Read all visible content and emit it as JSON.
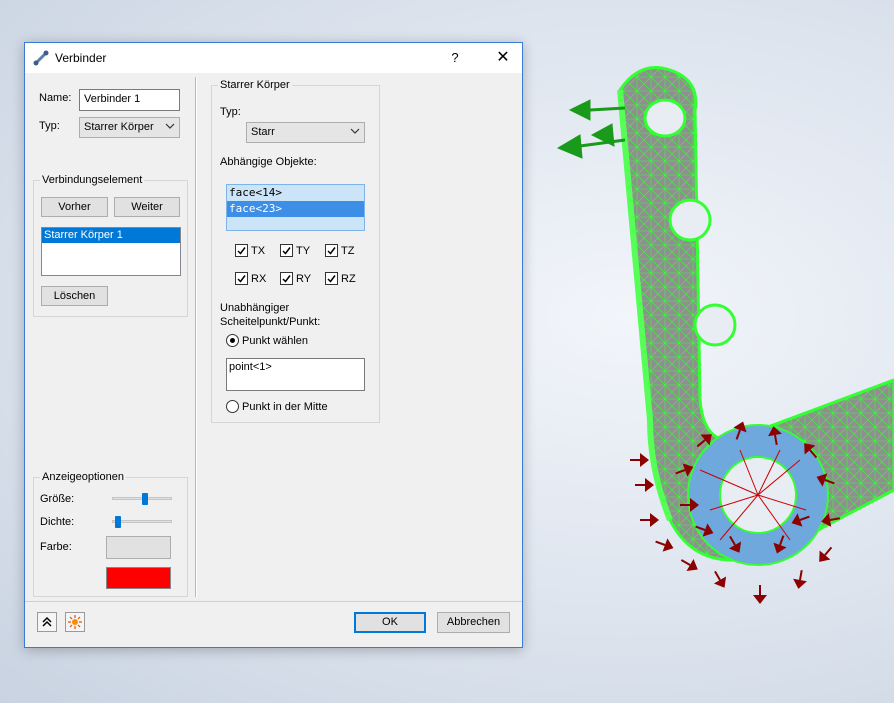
{
  "dialog": {
    "title": "Verbinder",
    "help_label": "?",
    "close_label": "✕"
  },
  "left": {
    "name_label": "Name:",
    "name_value": "Verbinder 1",
    "type_label": "Typ:",
    "type_value": "Starrer Körper",
    "connection_group": {
      "title": "Verbindungselement",
      "prev_button": "Vorher",
      "next_button": "Weiter",
      "items": [
        "Starrer Körper 1"
      ],
      "delete_button": "Löschen"
    },
    "display_group": {
      "title": "Anzeigeoptionen",
      "size_label": "Größe:",
      "size_value": 0.55,
      "density_label": "Dichte:",
      "density_value": 0.05,
      "color_label": "Farbe:",
      "color_swatch": "#ff0000"
    }
  },
  "right": {
    "group_title": "Starrer Körper",
    "type_label": "Typ:",
    "type_value": "Starr",
    "dependent_label": "Abhängige Objekte:",
    "dependent_items": [
      "face<14>",
      "face<23>"
    ],
    "checkboxes": [
      {
        "label": "TX",
        "checked": true
      },
      {
        "label": "TY",
        "checked": true
      },
      {
        "label": "TZ",
        "checked": true
      },
      {
        "label": "RX",
        "checked": true
      },
      {
        "label": "RY",
        "checked": true
      },
      {
        "label": "RZ",
        "checked": true
      }
    ],
    "independent_label_line1": "Unabhängiger",
    "independent_label_line2": "Scheitelpunkt/Punkt:",
    "radio_select_point": "Punkt wählen",
    "point_value": "point<1>",
    "radio_center_point": "Punkt in der Mitte"
  },
  "footer": {
    "ok_button": "OK",
    "cancel_button": "Abbrechen"
  },
  "colors": {
    "accent": "#0078d7",
    "mesh_green": "#33ff33",
    "mesh_gray": "#8c8c8c",
    "arrow_green": "#1a9a1a",
    "arrow_red": "#8b0000",
    "face_blue": "#6fa8dc"
  }
}
